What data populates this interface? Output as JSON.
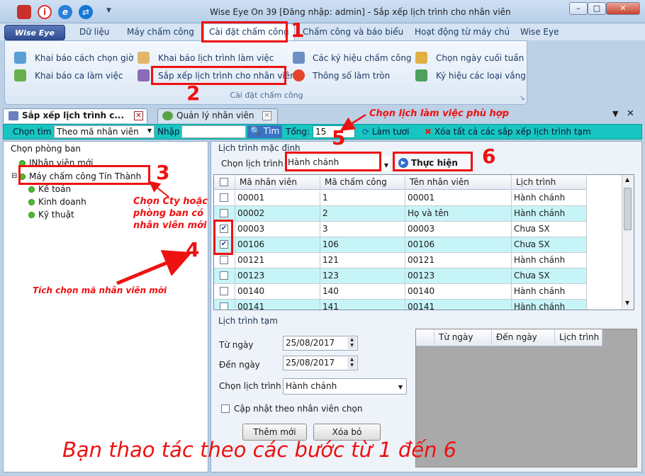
{
  "window": {
    "title": "Wise Eye On 39 [Đăng nhập: admin] - Sắp xếp lịch trình cho nhân viên",
    "controls": {
      "minimize": "–",
      "maximize": "□",
      "close": "✕"
    }
  },
  "menu": {
    "logo": "Wise Eye",
    "items": [
      "Dữ liệu",
      "Máy chấm công",
      "Cài đặt chấm công",
      "Chấm công và báo biểu",
      "Hoạt động từ máy chủ",
      "Wise Eye"
    ]
  },
  "ribbon": {
    "items": [
      "Khai báo cách chọn giờ",
      "Khai báo ca làm việc",
      "Khai báo lịch trình làm việc",
      "Sắp xếp lịch trình cho nhân viên",
      "Các ký hiệu chấm công",
      "Thông số làm tròn",
      "Chọn ngày cuối tuần",
      "Ký hiệu các loại vắng"
    ],
    "group": "Cài đặt chấm công"
  },
  "tabs": [
    "Sắp xếp lịch trình c...",
    "Quản lý nhân viên"
  ],
  "toolbar": {
    "search_label": "Chọn tìm",
    "search_mode": "Theo mã nhân viên",
    "input_label": "Nhập",
    "search_value": "",
    "find_button": "Tìm",
    "total_label": "Tổng:",
    "total": "15",
    "refresh": "Làm tươi",
    "clear_all": "Xóa tất cả các sắp xếp lịch trình tạm"
  },
  "departments": {
    "title": "Chọn phòng ban",
    "items": [
      "INhân viên mới",
      "Máy chấm công Tín Thành",
      "Kế toán",
      "Kinh doanh",
      "Kỹ thuật"
    ]
  },
  "default_schedule": {
    "title": "Lịch trình mặc định",
    "select_label": "Chọn lịch trình",
    "select_value": "Hành chánh",
    "execute_button": "Thực hiện",
    "columns": [
      "Mã nhân viên",
      "Mã chấm công",
      "Tên nhân viên",
      "Lịch trình"
    ],
    "rows": [
      {
        "checked": false,
        "emp": "00001",
        "code": "1",
        "name": "00001",
        "schedule": "Hành chánh"
      },
      {
        "checked": false,
        "emp": "00002",
        "code": "2",
        "name": "Họ và tên",
        "schedule": "Hành chánh"
      },
      {
        "checked": true,
        "emp": "00003",
        "code": "3",
        "name": "00003",
        "schedule": "Chưa SX"
      },
      {
        "checked": true,
        "emp": "00106",
        "code": "106",
        "name": "00106",
        "schedule": "Chưa SX"
      },
      {
        "checked": false,
        "emp": "00121",
        "code": "121",
        "name": "00121",
        "schedule": "Hành chánh"
      },
      {
        "checked": false,
        "emp": "00123",
        "code": "123",
        "name": "00123",
        "schedule": "Chưa SX"
      },
      {
        "checked": false,
        "emp": "00140",
        "code": "140",
        "name": "00140",
        "schedule": "Hành chánh"
      },
      {
        "checked": false,
        "emp": "00141",
        "code": "141",
        "name": "00141",
        "schedule": "Hành chánh"
      }
    ]
  },
  "temp_schedule": {
    "title": "Lịch trình tạm",
    "from_label": "Từ ngày",
    "from_value": "25/08/2017",
    "to_label": "Đến ngày",
    "to_value": "25/08/2017",
    "select_label": "Chọn lịch trình",
    "select_value": "Hành chánh",
    "update_checkbox": "Cập nhật theo nhân viên chọn",
    "add_button": "Thêm mới",
    "delete_button": "Xóa bỏ",
    "columns": [
      "Từ ngày",
      "Đến ngày",
      "Lịch trình"
    ]
  },
  "annotations": {
    "steps": [
      "1",
      "2",
      "3",
      "4",
      "5",
      "6"
    ],
    "note_schedule": "Chọn lịch làm việc phù hợp",
    "note_dept": [
      "Chọn Cty hoặc",
      "phòng ban có",
      "nhân viên mới"
    ],
    "note_tick": "Tích chọn mã nhân viên mới",
    "banner": "Bạn thao tác theo các bước từ 1 đến 6",
    "color": "#e11111"
  }
}
